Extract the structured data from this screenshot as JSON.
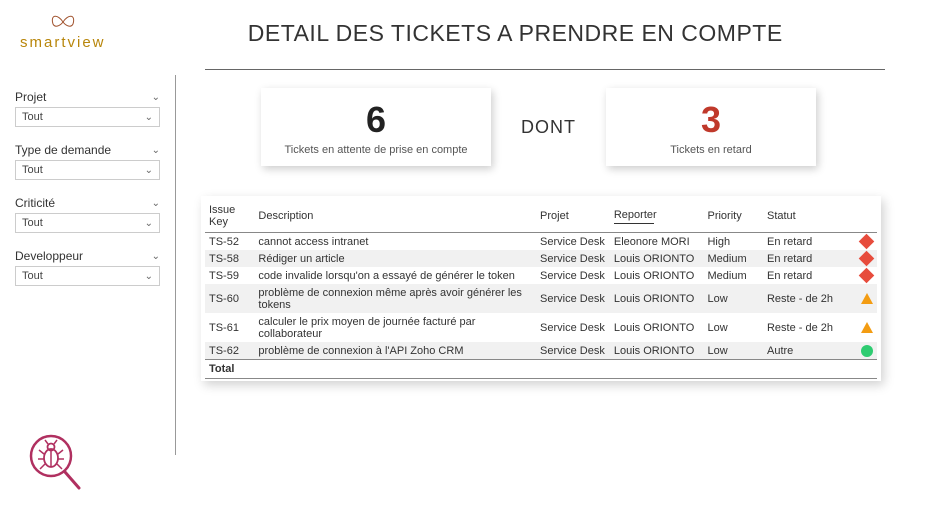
{
  "header": {
    "logo_text": "smartview",
    "title": "DETAIL DES TICKETS A PRENDRE EN COMPTE"
  },
  "filters": [
    {
      "label": "Projet",
      "value": "Tout"
    },
    {
      "label": "Type de demande",
      "value": "Tout"
    },
    {
      "label": "Criticité",
      "value": "Tout"
    },
    {
      "label": "Developpeur",
      "value": "Tout"
    }
  ],
  "cards": {
    "pending": {
      "number": "6",
      "label": "Tickets en attente de prise en compte"
    },
    "separator": "DONT",
    "late": {
      "number": "3",
      "label": "Tickets en retard"
    }
  },
  "table": {
    "headers": {
      "key": "Issue Key",
      "desc": "Description",
      "proj": "Projet",
      "rep": "Reporter",
      "pri": "Priority",
      "stat": "Statut"
    },
    "rows": [
      {
        "key": "TS-52",
        "desc": "cannot access intranet",
        "proj": "Service Desk",
        "rep": "Eleonore MORI",
        "pri": "High",
        "stat": "En retard",
        "icon": "diamond"
      },
      {
        "key": "TS-58",
        "desc": "Rédiger un article",
        "proj": "Service Desk",
        "rep": "Louis ORIONTO",
        "pri": "Medium",
        "stat": "En retard",
        "icon": "diamond"
      },
      {
        "key": "TS-59",
        "desc": "code invalide lorsqu'on a essayé de générer le token",
        "proj": "Service Desk",
        "rep": "Louis ORIONTO",
        "pri": "Medium",
        "stat": "En retard",
        "icon": "diamond"
      },
      {
        "key": "TS-60",
        "desc": "problème de connexion même après avoir générer les tokens",
        "proj": "Service Desk",
        "rep": "Louis ORIONTO",
        "pri": "Low",
        "stat": "Reste - de 2h",
        "icon": "triangle"
      },
      {
        "key": "TS-61",
        "desc": "calculer le prix moyen de journée facturé par collaborateur",
        "proj": "Service Desk",
        "rep": "Louis ORIONTO",
        "pri": "Low",
        "stat": "Reste - de 2h",
        "icon": "triangle"
      },
      {
        "key": "TS-62",
        "desc": "problème de connexion à l'API Zoho CRM",
        "proj": "Service Desk",
        "rep": "Louis ORIONTO",
        "pri": "Low",
        "stat": "Autre",
        "icon": "circle"
      }
    ],
    "total_label": "Total"
  }
}
